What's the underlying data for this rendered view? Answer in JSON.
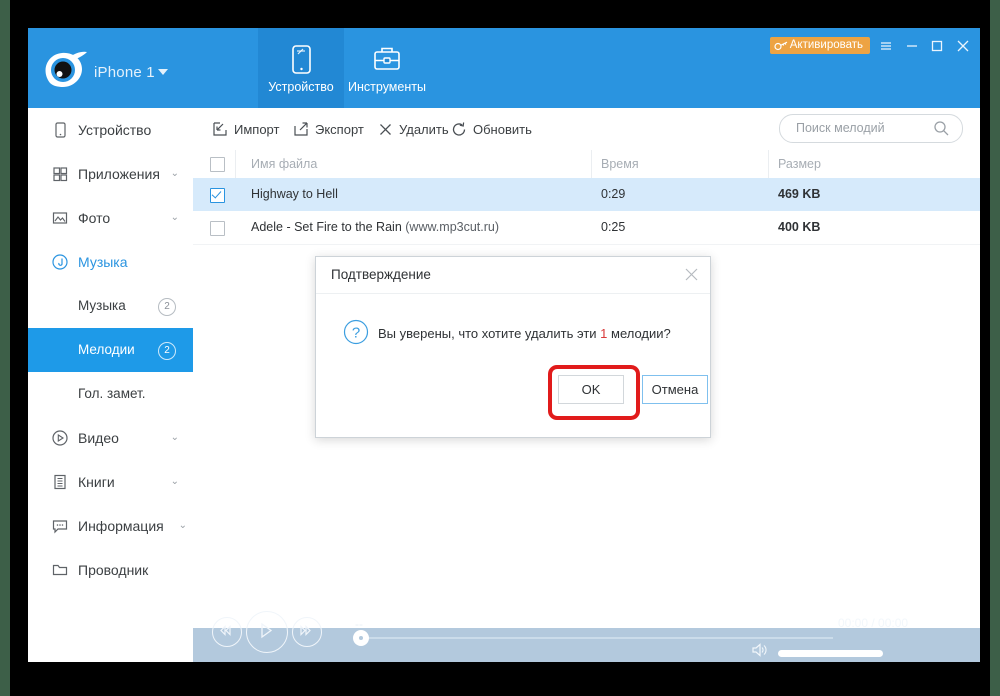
{
  "header": {
    "device_name": "iPhone 1",
    "logo_icon": "itools-eye-logo",
    "caret_icon": "chevron-down-icon",
    "tabs": [
      {
        "label": "Устройство",
        "icon": "tablet-icon",
        "active": true
      },
      {
        "label": "Инструменты",
        "icon": "briefcase-icon",
        "active": false
      }
    ],
    "activate_label": "Активировать",
    "activate_icon": "key-icon",
    "activate_color": "#eda343",
    "window_buttons": [
      {
        "name": "menu-button",
        "icon": "hamburger-icon"
      },
      {
        "name": "minimize-button",
        "icon": "minimize-icon"
      },
      {
        "name": "maximize-button",
        "icon": "maximize-icon"
      },
      {
        "name": "close-button",
        "icon": "close-icon"
      }
    ],
    "brand_color": "#2a94e0"
  },
  "sidebar": {
    "items": [
      {
        "label": "Устройство",
        "icon": "phone-icon",
        "caret": "",
        "accent": false
      },
      {
        "label": "Приложения",
        "icon": "grid-icon",
        "caret": "⌄",
        "accent": false
      },
      {
        "label": "Фото",
        "icon": "image-icon",
        "caret": "⌄",
        "accent": false
      },
      {
        "label": "Музыка",
        "icon": "music-circle-icon",
        "caret": "",
        "accent": true
      }
    ],
    "sub_items": [
      {
        "label": "Музыка",
        "badge": "2",
        "selected": false
      },
      {
        "label": "Мелодии",
        "badge": "2",
        "selected": true
      },
      {
        "label": "Гол. замет.",
        "badge": "",
        "selected": false
      }
    ],
    "items_after": [
      {
        "label": "Видео",
        "icon": "play-circle-icon",
        "caret": "⌄",
        "accent": false
      },
      {
        "label": "Книги",
        "icon": "book-icon",
        "caret": "⌄",
        "accent": false
      },
      {
        "label": "Информация",
        "icon": "chat-icon",
        "caret": "⌄",
        "accent": false
      },
      {
        "label": "Проводник",
        "icon": "folder-icon",
        "caret": "",
        "accent": false
      }
    ],
    "selected_color": "#1e9ae8"
  },
  "toolbar": {
    "buttons": [
      {
        "label": "Импорт",
        "icon": "import-icon"
      },
      {
        "label": "Экспорт",
        "icon": "export-icon"
      },
      {
        "label": "Удалить",
        "icon": "delete-x-icon"
      },
      {
        "label": "Обновить",
        "icon": "refresh-icon"
      }
    ],
    "search_placeholder": "Поиск мелодий",
    "search_value": "",
    "search_icon": "search-icon"
  },
  "table": {
    "columns": [
      "Имя файла",
      "Время",
      "Размер"
    ],
    "header_checkbox_checked": false,
    "rows": [
      {
        "checked": true,
        "name": "Highway to Hell",
        "name_suffix": "",
        "time": "0:29",
        "size": "469 KB",
        "selected": true
      },
      {
        "checked": false,
        "name": "Adele - Set Fire to the Rain ",
        "name_suffix": "(www.mp3cut.ru)",
        "time": "0:25",
        "size": "400 KB",
        "selected": false
      }
    ]
  },
  "player": {
    "prev_icon": "rewind-icon",
    "play_icon": "play-icon",
    "next_icon": "fast-forward-icon",
    "track_title": "--",
    "time_display": "00:00 / 00:00",
    "speaker_icon": "volume-icon",
    "progress_percent": 0,
    "volume_percent": 100,
    "background_color": "#b3c9dd"
  },
  "modal": {
    "title": "Подтверждение",
    "close_icon": "close-icon",
    "question_icon": "question-circle-icon",
    "message_before": "Вы уверены, что хотите удалить эти ",
    "message_count": "1",
    "message_after": " мелодии?",
    "ok_label": "OK",
    "cancel_label": "Отмена",
    "highlight_color": "#e11b1b",
    "count_color": "#d93a3a"
  }
}
